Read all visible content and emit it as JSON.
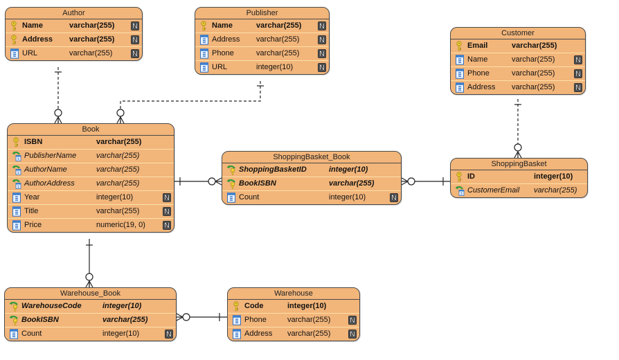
{
  "diagram": {
    "type": "ER diagram",
    "colors": {
      "entity_fill": "#f2b57a",
      "entity_border": "#4a4a4a",
      "row_divider": "#fde2a8",
      "key_icon": "#e8c21a",
      "fk_arrow": "#2e9a3a",
      "column_icon": "#3a7fd0"
    },
    "entities": [
      {
        "id": "author",
        "name": "Author",
        "columns": [
          {
            "name": "Name",
            "type": "varchar(255)",
            "kind": "pk",
            "nullable_marker": "N"
          },
          {
            "name": "Address",
            "type": "varchar(255)",
            "kind": "pk",
            "nullable_marker": "N"
          },
          {
            "name": "URL",
            "type": "varchar(255)",
            "kind": "col",
            "nullable_marker": "N"
          }
        ]
      },
      {
        "id": "publisher",
        "name": "Publisher",
        "columns": [
          {
            "name": "Name",
            "type": "varchar(255)",
            "kind": "pk",
            "nullable_marker": "N"
          },
          {
            "name": "Address",
            "type": "varchar(255)",
            "kind": "col",
            "nullable_marker": "N"
          },
          {
            "name": "Phone",
            "type": "varchar(255)",
            "kind": "col",
            "nullable_marker": "N"
          },
          {
            "name": "URL",
            "type": "integer(10)",
            "kind": "col",
            "nullable_marker": "N"
          }
        ]
      },
      {
        "id": "customer",
        "name": "Customer",
        "columns": [
          {
            "name": "Email",
            "type": "varchar(255)",
            "kind": "pk",
            "nullable_marker": ""
          },
          {
            "name": "Name",
            "type": "varchar(255)",
            "kind": "col",
            "nullable_marker": "N"
          },
          {
            "name": "Phone",
            "type": "varchar(255)",
            "kind": "col",
            "nullable_marker": "N"
          },
          {
            "name": "Address",
            "type": "varchar(255)",
            "kind": "col",
            "nullable_marker": "N"
          }
        ]
      },
      {
        "id": "book",
        "name": "Book",
        "columns": [
          {
            "name": "ISBN",
            "type": "varchar(255)",
            "kind": "pk",
            "nullable_marker": ""
          },
          {
            "name": "PublisherName",
            "type": "varchar(255)",
            "kind": "fk",
            "nullable_marker": ""
          },
          {
            "name": "AuthorName",
            "type": "varchar(255)",
            "kind": "fk",
            "nullable_marker": ""
          },
          {
            "name": "AuthorAddress",
            "type": "varchar(255)",
            "kind": "fk",
            "nullable_marker": ""
          },
          {
            "name": "Year",
            "type": "integer(10)",
            "kind": "col",
            "nullable_marker": "N"
          },
          {
            "name": "Title",
            "type": "varchar(255)",
            "kind": "col",
            "nullable_marker": "N"
          },
          {
            "name": "Price",
            "type": "numeric(19, 0)",
            "kind": "col",
            "nullable_marker": "N"
          }
        ]
      },
      {
        "id": "shoppingbasket_book",
        "name": "ShoppingBasket_Book",
        "columns": [
          {
            "name": "ShoppingBasketID",
            "type": "integer(10)",
            "kind": "pfk",
            "nullable_marker": ""
          },
          {
            "name": "BookISBN",
            "type": "varchar(255)",
            "kind": "pfk",
            "nullable_marker": ""
          },
          {
            "name": "Count",
            "type": "integer(10)",
            "kind": "col",
            "nullable_marker": "N"
          }
        ]
      },
      {
        "id": "shoppingbasket",
        "name": "ShoppingBasket",
        "columns": [
          {
            "name": "ID",
            "type": "integer(10)",
            "kind": "pk",
            "nullable_marker": ""
          },
          {
            "name": "CustomerEmail",
            "type": "varchar(255)",
            "kind": "fk",
            "nullable_marker": ""
          }
        ]
      },
      {
        "id": "warehouse_book",
        "name": "Warehouse_Book",
        "columns": [
          {
            "name": "WarehouseCode",
            "type": "integer(10)",
            "kind": "pfk",
            "nullable_marker": ""
          },
          {
            "name": "BookISBN",
            "type": "varchar(255)",
            "kind": "pfk",
            "nullable_marker": ""
          },
          {
            "name": "Count",
            "type": "integer(10)",
            "kind": "col",
            "nullable_marker": "N"
          }
        ]
      },
      {
        "id": "warehouse",
        "name": "Warehouse",
        "columns": [
          {
            "name": "Code",
            "type": "integer(10)",
            "kind": "pk",
            "nullable_marker": ""
          },
          {
            "name": "Phone",
            "type": "varchar(255)",
            "kind": "col",
            "nullable_marker": "N"
          },
          {
            "name": "Address",
            "type": "varchar(255)",
            "kind": "col",
            "nullable_marker": "N"
          }
        ]
      }
    ],
    "relationships": [
      {
        "id": "author-book",
        "from": "Author",
        "to": "Book",
        "from_cardinality": "one",
        "to_cardinality": "zero-or-many",
        "style": "dashed"
      },
      {
        "id": "publisher-book",
        "from": "Publisher",
        "to": "Book",
        "from_cardinality": "one",
        "to_cardinality": "zero-or-many",
        "style": "dashed"
      },
      {
        "id": "customer-shoppingbasket",
        "from": "Customer",
        "to": "ShoppingBasket",
        "from_cardinality": "one",
        "to_cardinality": "zero-or-many",
        "style": "dashed"
      },
      {
        "id": "book-shoppingbasket_book",
        "from": "Book",
        "to": "ShoppingBasket_Book",
        "from_cardinality": "one",
        "to_cardinality": "zero-or-many",
        "style": "solid"
      },
      {
        "id": "shoppingbasket-shoppingbasket_book",
        "from": "ShoppingBasket",
        "to": "ShoppingBasket_Book",
        "from_cardinality": "one",
        "to_cardinality": "zero-or-many",
        "style": "solid"
      },
      {
        "id": "book-warehouse_book",
        "from": "Book",
        "to": "Warehouse_Book",
        "from_cardinality": "one",
        "to_cardinality": "zero-or-many",
        "style": "solid"
      },
      {
        "id": "warehouse-warehouse_book",
        "from": "Warehouse",
        "to": "Warehouse_Book",
        "from_cardinality": "one",
        "to_cardinality": "zero-or-many",
        "style": "solid"
      }
    ]
  }
}
